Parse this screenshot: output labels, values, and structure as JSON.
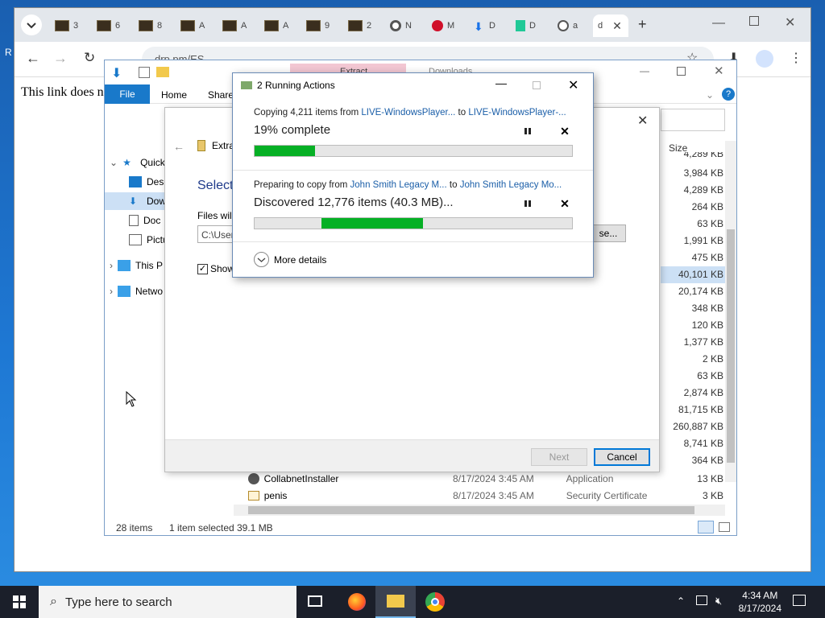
{
  "browser": {
    "tabs": [
      "3",
      "6",
      "8",
      "A",
      "A",
      "A",
      "9",
      "2",
      "N",
      "M",
      "D",
      "D",
      "a",
      "d"
    ],
    "address": "drp.pm/ES",
    "page_text": "This link does n",
    "side_letter": "R"
  },
  "explorer": {
    "ribbon": {
      "file": "File",
      "home": "Home",
      "share": "Share"
    },
    "behind_titles": {
      "extract": "Extract",
      "downloads": "Downloads"
    },
    "nav": [
      "Quick",
      "Desk",
      "Dow",
      "Doc",
      "Pictu",
      "This P",
      "Netwo"
    ],
    "size_header": "Size",
    "sizes": [
      "4,289 KB",
      "3,984 KB",
      "4,289 KB",
      "264 KB",
      "63 KB",
      "1,991 KB",
      "475 KB",
      "40,101 KB",
      "20,174 KB",
      "348 KB",
      "120 KB",
      "1,377 KB",
      "2 KB",
      "63 KB",
      "2,874 KB",
      "81,715 KB",
      "260,887 KB",
      "8,741 KB",
      "364 KB"
    ],
    "rows": [
      {
        "name": "CollabnetInstaller",
        "date": "8/17/2024 3:45 AM",
        "type": "Application",
        "size": "13 KB"
      },
      {
        "name": "penis",
        "date": "8/17/2024 3:45 AM",
        "type": "Security Certificate",
        "size": "3 KB"
      }
    ],
    "status": {
      "count": "28 items",
      "selected": "1 item selected",
      "size": "39.1 MB"
    }
  },
  "wizard": {
    "title_short": "Extra",
    "heading": "Select",
    "files_label": "Files will",
    "path_value": "C:\\User",
    "browse_label": "se...",
    "show_label": "Show",
    "next_label": "Next",
    "cancel_label": "Cancel"
  },
  "dialog": {
    "title": "2 Running Actions",
    "op1": {
      "prefix": "Copying 4,211 items from ",
      "source": "LIVE-WindowsPlayer...",
      "to": " to ",
      "dest": "LIVE-WindowsPlayer-...",
      "status": "19% complete",
      "progress": 0.19
    },
    "op2": {
      "prefix": "Preparing to copy from ",
      "source": "John Smith Legacy M...",
      "to": " to ",
      "dest": "John Smith Legacy Mo...",
      "status": "Discovered 12,776 items (40.3 MB)...",
      "progress_start": 0.21,
      "progress_end": 0.53
    },
    "more_details": "More details"
  },
  "taskbar": {
    "search_placeholder": "Type here to search",
    "time": "4:34 AM",
    "date": "8/17/2024"
  },
  "colors": {
    "progress": "#06b025",
    "link": "#1a5ea8",
    "ribbon_file": "#1979ca"
  }
}
